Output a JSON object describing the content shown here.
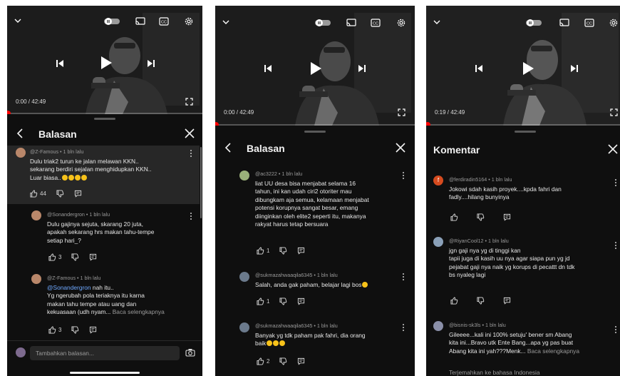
{
  "colors": {
    "bg": "#0f0f0f",
    "accent": "#ff0000",
    "link": "#6ea8ff",
    "muted": "#9a9a9a"
  },
  "icons": [
    "chevron-down-icon",
    "autoplay-toggle-icon",
    "cast-icon",
    "cc-icon",
    "settings-icon",
    "prev-icon",
    "play-icon",
    "next-icon",
    "fullscreen-icon",
    "back-arrow-icon",
    "close-icon",
    "like-icon",
    "dislike-icon",
    "reply-icon",
    "more-vert-icon",
    "camera-icon"
  ],
  "screen1": {
    "video": {
      "time": "0:00 / 42:49",
      "progress": 0.0
    },
    "panel_title": "Balasan",
    "comments": [
      {
        "author": "@Z-Famous • 1 bln lalu",
        "text": "Dulu triak2 turun ke jalan melawan KKN..\nsekarang berdiri sejalan menghidupkan KKN..\nLuar biasa..",
        "likes": "44"
      },
      {
        "author": "@Sonandergron • 1 bln lalu",
        "text": "Dulu gajinya sejuta, skarang 20 juta,\napakah sekarang hrs makan tahu-tempe\nsetiap hari_?",
        "likes": "3"
      },
      {
        "author": "@Z-Famous • 1 bln lalu",
        "mention": "@Sonandergron",
        "text_after_mention": "  nah itu..",
        "text": "Yg ngerubah pola teriaknya itu karna\nmakan tahu tempe atau uang dan\nkekuasaan (udh nyam...",
        "more": "Baca selengkapnya",
        "likes": "3"
      }
    ],
    "reply_placeholder": "Tambahkan balasan..."
  },
  "screen2": {
    "video": {
      "time": "0:00 / 42:49",
      "progress": 0.0
    },
    "panel_title": "Balasan",
    "comments": [
      {
        "author": "@ac3222 • 1 bln lalu",
        "text": "liat UU desa bisa menjabat selama 16\ntahun, ini kan udah ciri2 otoriter mau\ndibungkam aja semua, kelamaan menjabat\npotensi korupnya sangat besar, emang\ndiinginkan oleh elite2 seperti itu, makanya\nrakyat harus tetap bersuara",
        "likes": "1"
      },
      {
        "author": "@sukmazahwaaqila6345 • 1 bln lalu",
        "text": "Salah, anda gak paham, belajar lagi  bos",
        "likes": "1"
      },
      {
        "author": "@sukmazahwaaqila6345 • 1 bln lalu",
        "text": "Banyak yg tdk paham pak fahri, dia orang\nbaik",
        "likes": "2"
      }
    ]
  },
  "screen3": {
    "video": {
      "time": "0:19 / 42:49",
      "progress": 0.0074
    },
    "panel_title": "Komentar",
    "comments": [
      {
        "author": "@ferdiradin5164 • 1 bln lalu",
        "avatar_letter": "f",
        "text": "Jokowi sdah kasih proyek....kpda fahri dan\nfadly....hilang bunyinya",
        "likes": ""
      },
      {
        "author": "@RiyanCool12 • 1 bln lalu",
        "text": "jgn gaji nya yg di tinggi kan\ntapii juga di kasih uu nya agar siapa pun yg jd\npejabat gaji nya naik yg korups di pecattt dn tdk\nbs nyaleg lagi",
        "likes": ""
      },
      {
        "author": "@bisnis-sk3ls • 1 bln lalu",
        "text": "Gileeee...kali ini 100% setuju' bener sm Abang\nkita ini...Bravo  utk Ente Bang...apa yg pas buat\nAbang kita ini yah???Menk...",
        "more": "Baca selengkapnya",
        "likes": ""
      }
    ],
    "translate": "Terjemahkan ke bahasa Indonesia"
  }
}
